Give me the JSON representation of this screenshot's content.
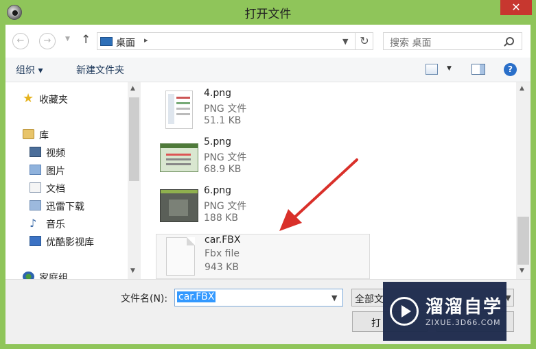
{
  "window": {
    "title": "打开文件",
    "close_glyph": "✕"
  },
  "navigation": {
    "back_glyph": "←",
    "forward_glyph": "→",
    "up_glyph": "↑",
    "address_location": "桌面",
    "address_separator": "▸",
    "refresh_glyph": "↻",
    "search_placeholder": "搜索 桌面"
  },
  "toolbar": {
    "organize_label": "组织 ▾",
    "new_folder_label": "新建文件夹",
    "help_glyph": "?"
  },
  "sidebar": {
    "items": [
      {
        "label": "收藏夹",
        "icon": "star-icon"
      },
      {
        "label": "库",
        "icon": "library-icon"
      },
      {
        "label": "视频",
        "icon": "video-icon"
      },
      {
        "label": "图片",
        "icon": "pictures-icon"
      },
      {
        "label": "文档",
        "icon": "documents-icon"
      },
      {
        "label": "迅雷下载",
        "icon": "download-icon"
      },
      {
        "label": "音乐",
        "icon": "music-icon"
      },
      {
        "label": "优酷影视库",
        "icon": "youku-icon"
      },
      {
        "label": "家庭组",
        "icon": "homegroup-icon"
      }
    ]
  },
  "files": [
    {
      "name": "4.png",
      "type": "PNG 文件",
      "size": "51.1 KB"
    },
    {
      "name": "5.png",
      "type": "PNG 文件",
      "size": "68.9 KB"
    },
    {
      "name": "6.png",
      "type": "PNG 文件",
      "size": "188 KB"
    },
    {
      "name": "car.FBX",
      "type": "Fbx file",
      "size": "943 KB"
    }
  ],
  "footer": {
    "filename_label": "文件名(N):",
    "filename_value": "car.FBX",
    "filetype_value": "全部文",
    "open_label": "打"
  },
  "watermark": {
    "title": "溜溜自学",
    "url": "ZIXUE.3D66.COM"
  },
  "colors": {
    "frame": "#8fc55a",
    "close_button": "#c7372f",
    "selection": "#3399ff",
    "annotation_arrow": "#d9302a",
    "watermark_bg": "#1d2a4c"
  }
}
